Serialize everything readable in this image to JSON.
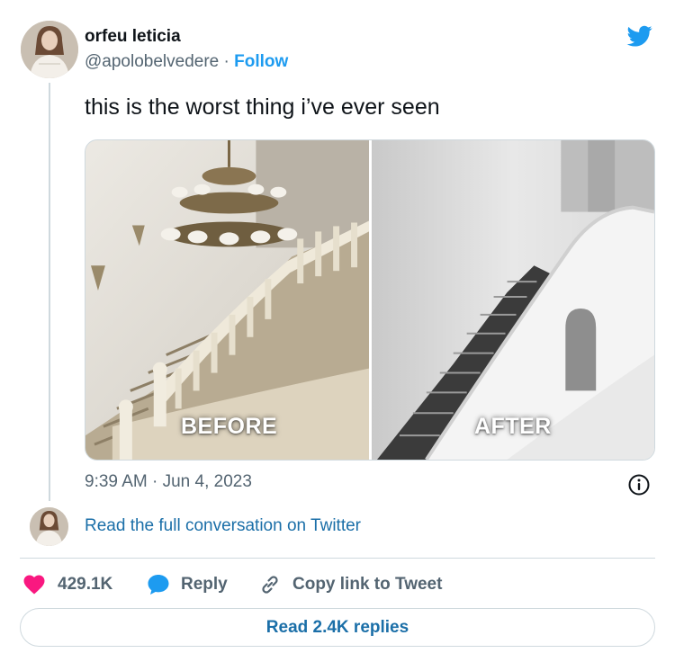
{
  "tweet": {
    "author": {
      "name": "orfeu leticia",
      "handle": "@apolobelvedere",
      "separator": "·",
      "follow_label": "Follow"
    },
    "text": "this is the worst thing i’ve ever seen",
    "media": {
      "labels": {
        "before": "BEFORE",
        "after": "AFTER"
      }
    },
    "timestamp": "9:39 AM · Jun 4, 2023",
    "read_conversation": "Read the full conversation on Twitter",
    "actions": {
      "like_count": "429.1K",
      "reply_label": "Reply",
      "copy_link_label": "Copy link to Tweet"
    },
    "read_replies": "Read 2.4K replies"
  },
  "icons": {
    "brand": "twitter-bird-icon",
    "like": "heart-icon",
    "reply": "speech-bubble-icon",
    "copy": "link-icon",
    "info": "info-icon"
  },
  "colors": {
    "twitter_blue": "#1d9bf0",
    "link_blue": "#1b6fa8",
    "like_red": "#f91880",
    "secondary_text": "#536471",
    "border": "#cfd9de"
  }
}
